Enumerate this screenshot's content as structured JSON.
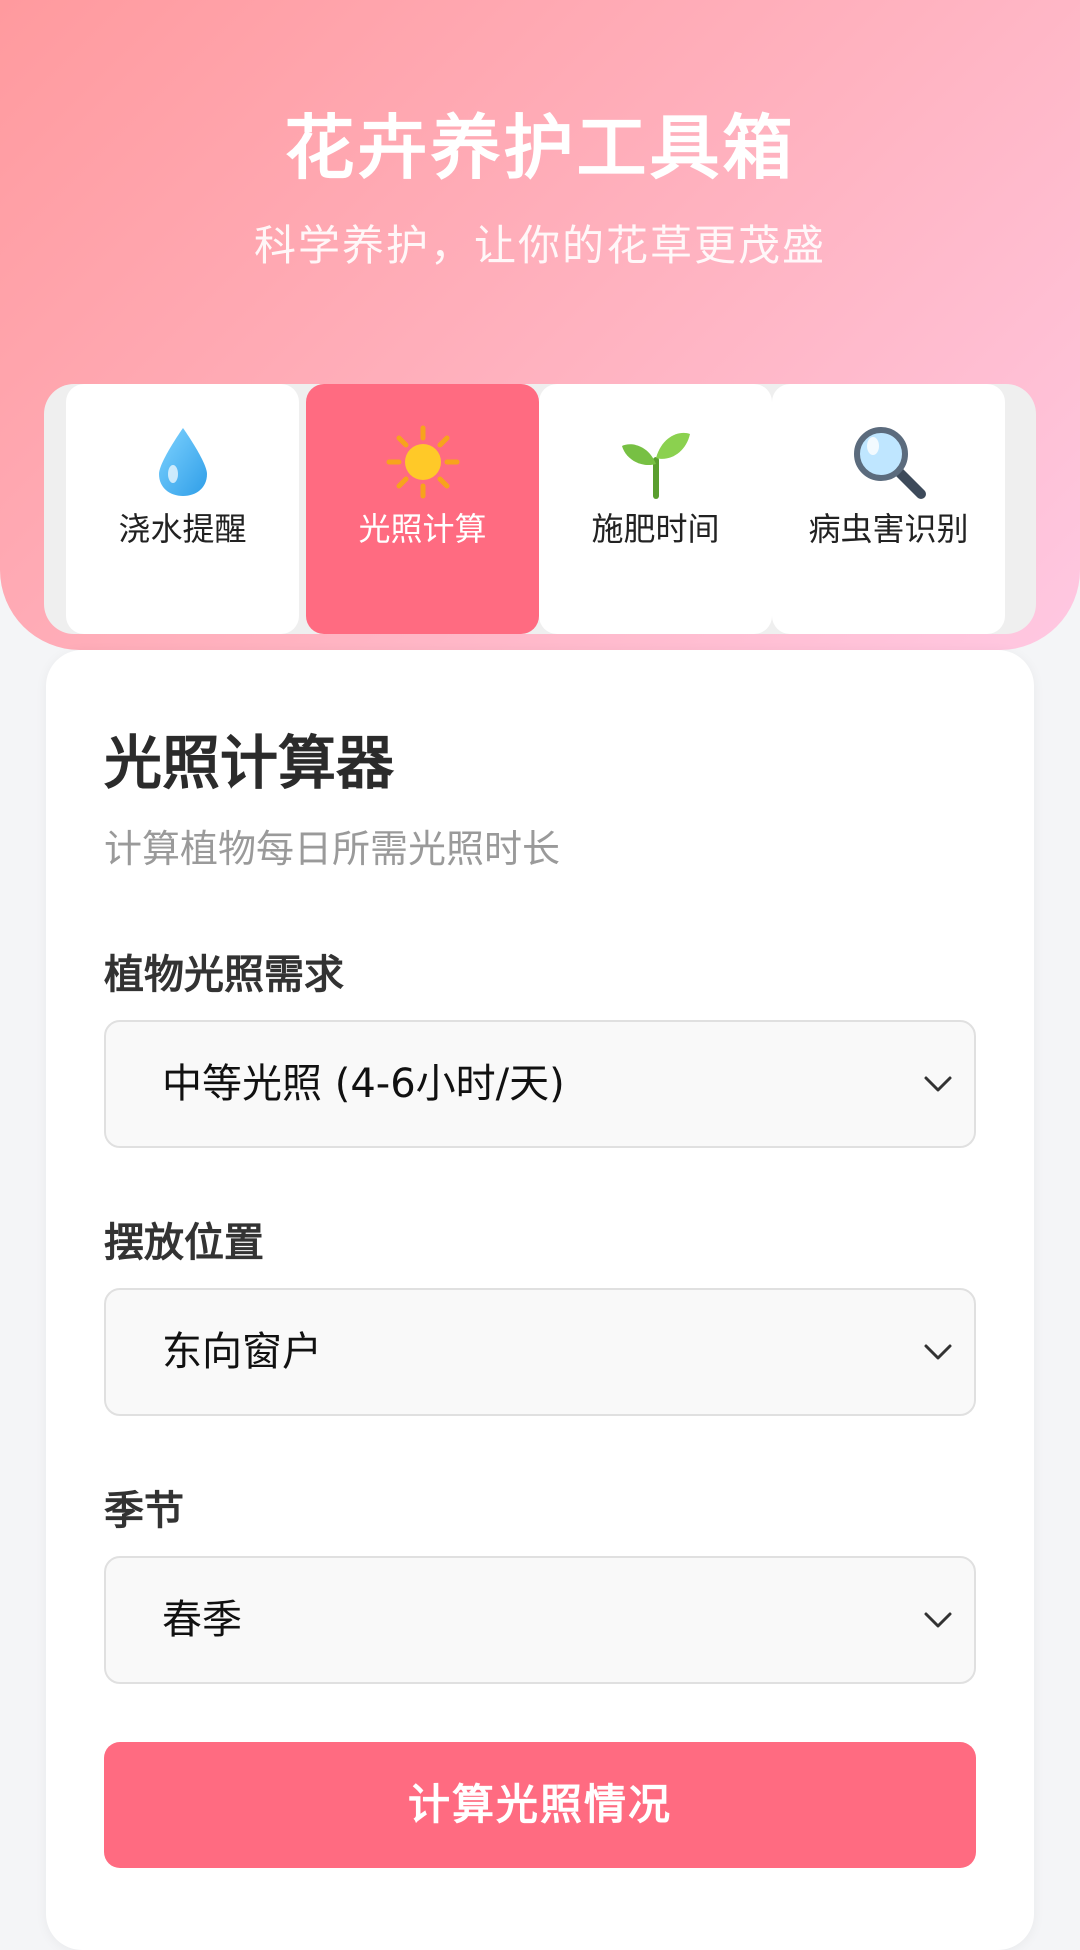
{
  "header": {
    "title": "花卉养护工具箱",
    "subtitle": "科学养护，让你的花草更茂盛"
  },
  "tabs": [
    {
      "label": "浇水提醒",
      "icon": "water-drop-icon",
      "active": false
    },
    {
      "label": "光照计算",
      "icon": "sun-icon",
      "active": true
    },
    {
      "label": "施肥时间",
      "icon": "seedling-icon",
      "active": false
    },
    {
      "label": "病虫害识别",
      "icon": "magnifier-icon",
      "active": false
    }
  ],
  "card": {
    "title": "光照计算器",
    "subtitle": "计算植物每日所需光照时长",
    "fields": [
      {
        "label": "植物光照需求",
        "value": "中等光照 (4-6小时/天)"
      },
      {
        "label": "摆放位置",
        "value": "东向窗户"
      },
      {
        "label": "季节",
        "value": "春季"
      }
    ],
    "button_label": "计算光照情况"
  },
  "colors": {
    "accent": "#ff6b81",
    "header_gradient_start": "#ff9a9e",
    "header_gradient_end": "#ffc8e2"
  }
}
